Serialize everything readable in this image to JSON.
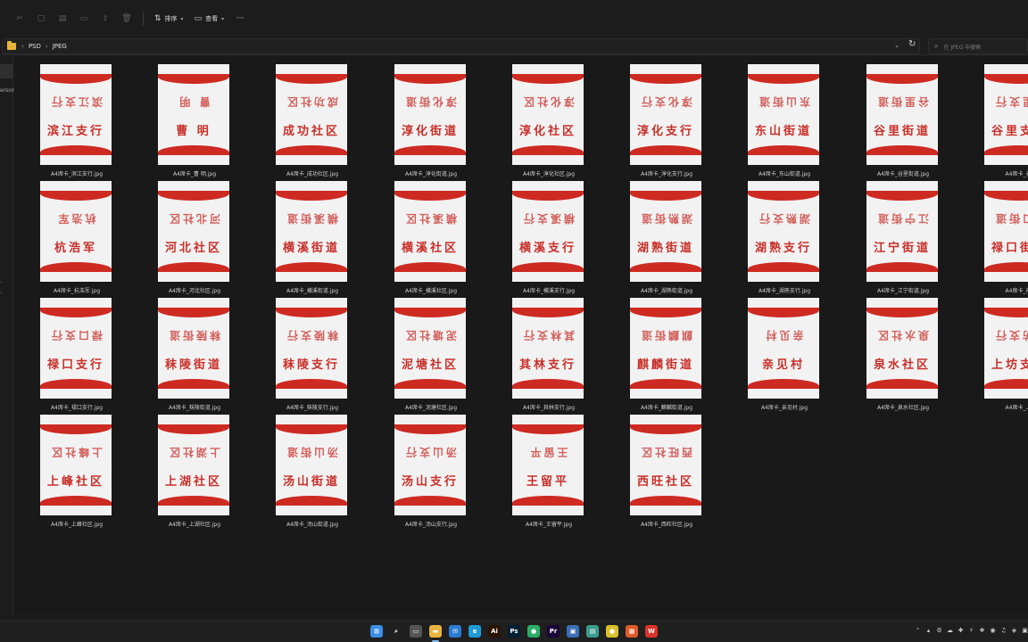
{
  "toolbar": {
    "sort_label": "排序",
    "view_label": "查看",
    "more_label": "···"
  },
  "addressbar": {
    "crumbs": [
      "PSD",
      "JPEG"
    ]
  },
  "search": {
    "placeholder": "在 JPEG 中搜索"
  },
  "navpane": {
    "partial_label": "erson"
  },
  "files": [
    {
      "top": "滨江支行",
      "bottom": "滨江支行",
      "name": "A4席卡_滨江支行.jpg"
    },
    {
      "top": "曹  明",
      "bottom": "曹  明",
      "name": "A4席卡_曹 明.jpg"
    },
    {
      "top": "成功社区",
      "bottom": "成功社区",
      "name": "A4席卡_成功社区.jpg"
    },
    {
      "top": "淳化街道",
      "bottom": "淳化街道",
      "name": "A4席卡_淳化街道.jpg"
    },
    {
      "top": "淳化社区",
      "bottom": "淳化社区",
      "name": "A4席卡_淳化社区.jpg"
    },
    {
      "top": "淳化支行",
      "bottom": "淳化支行",
      "name": "A4席卡_淳化支行.jpg"
    },
    {
      "top": "东山街道",
      "bottom": "东山街道",
      "name": "A4席卡_东山街道.jpg"
    },
    {
      "top": "谷里街道",
      "bottom": "谷里街道",
      "name": "A4席卡_谷里街道.jpg"
    },
    {
      "top": "谷里支行",
      "bottom": "谷里支行",
      "name": "A4席卡_谷里"
    },
    {
      "top": "杭浩军",
      "bottom": "杭浩军",
      "name": "A4席卡_杭浩军.jpg"
    },
    {
      "top": "河北社区",
      "bottom": "河北社区",
      "name": "A4席卡_河北社区.jpg"
    },
    {
      "top": "横溪街道",
      "bottom": "横溪街道",
      "name": "A4席卡_横溪街道.jpg"
    },
    {
      "top": "横溪社区",
      "bottom": "横溪社区",
      "name": "A4席卡_横溪社区.jpg"
    },
    {
      "top": "横溪支行",
      "bottom": "横溪支行",
      "name": "A4席卡_横溪支行.jpg"
    },
    {
      "top": "湖熟街道",
      "bottom": "湖熟街道",
      "name": "A4席卡_湖熟街道.jpg"
    },
    {
      "top": "湖熟支行",
      "bottom": "湖熟支行",
      "name": "A4席卡_湖熟支行.jpg"
    },
    {
      "top": "江宁街道",
      "bottom": "江宁街道",
      "name": "A4席卡_江宁街道.jpg"
    },
    {
      "top": "禄口街道",
      "bottom": "禄口街道",
      "name": "A4席卡_禄口"
    },
    {
      "top": "禄口支行",
      "bottom": "禄口支行",
      "name": "A4席卡_禄口支行.jpg"
    },
    {
      "top": "秣陵街道",
      "bottom": "秣陵街道",
      "name": "A4席卡_秣陵街道.jpg"
    },
    {
      "top": "秣陵支行",
      "bottom": "秣陵支行",
      "name": "A4席卡_秣陵支行.jpg"
    },
    {
      "top": "泥塘社区",
      "bottom": "泥塘社区",
      "name": "A4席卡_泥塘社区.jpg"
    },
    {
      "top": "其林支行",
      "bottom": "其林支行",
      "name": "A4席卡_其林支行.jpg"
    },
    {
      "top": "麒麟街道",
      "bottom": "麒麟街道",
      "name": "A4席卡_麒麟街道.jpg"
    },
    {
      "top": "亲见村",
      "bottom": "亲见村",
      "name": "A4席卡_亲见村.jpg"
    },
    {
      "top": "泉水社区",
      "bottom": "泉水社区",
      "name": "A4席卡_泉水社区.jpg"
    },
    {
      "top": "上坊支行",
      "bottom": "上坊支行",
      "name": "A4席卡_上坊"
    },
    {
      "top": "上峰社区",
      "bottom": "上峰社区",
      "name": "A4席卡_上峰社区.jpg"
    },
    {
      "top": "上湖社区",
      "bottom": "上湖社区",
      "name": "A4席卡_上湖社区.jpg"
    },
    {
      "top": "汤山街道",
      "bottom": "汤山街道",
      "name": "A4席卡_汤山街道.jpg"
    },
    {
      "top": "汤山支行",
      "bottom": "汤山支行",
      "name": "A4席卡_汤山支行.jpg"
    },
    {
      "top": "王留平",
      "bottom": "王留平",
      "name": "A4席卡_王留平.jpg"
    },
    {
      "top": "西旺社区",
      "bottom": "西旺社区",
      "name": "A4席卡_西旺社区.jpg"
    }
  ],
  "taskbar": {
    "apps": [
      {
        "name": "start-icon",
        "color": "#3a8ee6",
        "glyph": "⊞"
      },
      {
        "name": "search-icon",
        "color": "transparent",
        "glyph": "⌕"
      },
      {
        "name": "taskview-icon",
        "color": "#555555",
        "glyph": "▭"
      },
      {
        "name": "file-explorer-icon",
        "color": "#e8b43d",
        "glyph": "▬"
      },
      {
        "name": "mail-icon",
        "color": "#2b7cd3",
        "glyph": "✉"
      },
      {
        "name": "edge-icon",
        "color": "#1e9bd7",
        "glyph": "e"
      },
      {
        "name": "illustrator-icon",
        "color": "#2a1400",
        "glyph": "Ai"
      },
      {
        "name": "photoshop-icon",
        "color": "#001e36",
        "glyph": "Ps"
      },
      {
        "name": "wechat-icon",
        "color": "#2aae67",
        "glyph": "●"
      },
      {
        "name": "premiere-icon",
        "color": "#1a0038",
        "glyph": "Pr"
      },
      {
        "name": "app-blue-icon",
        "color": "#3b6fb6",
        "glyph": "▣"
      },
      {
        "name": "app-teal-icon",
        "color": "#3a9c8c",
        "glyph": "▤"
      },
      {
        "name": "app-yellow-icon",
        "color": "#d9c02c",
        "glyph": "●"
      },
      {
        "name": "app-red-icon",
        "color": "#e05a2a",
        "glyph": "▦"
      },
      {
        "name": "wps-icon",
        "color": "#d8332a",
        "glyph": "W"
      }
    ],
    "tray_icons": [
      "⌃",
      "▴",
      "⚙",
      "☁",
      "✚",
      "⚡",
      "❖",
      "◉",
      "♫",
      "◈",
      "▣",
      "中",
      "☰"
    ]
  }
}
